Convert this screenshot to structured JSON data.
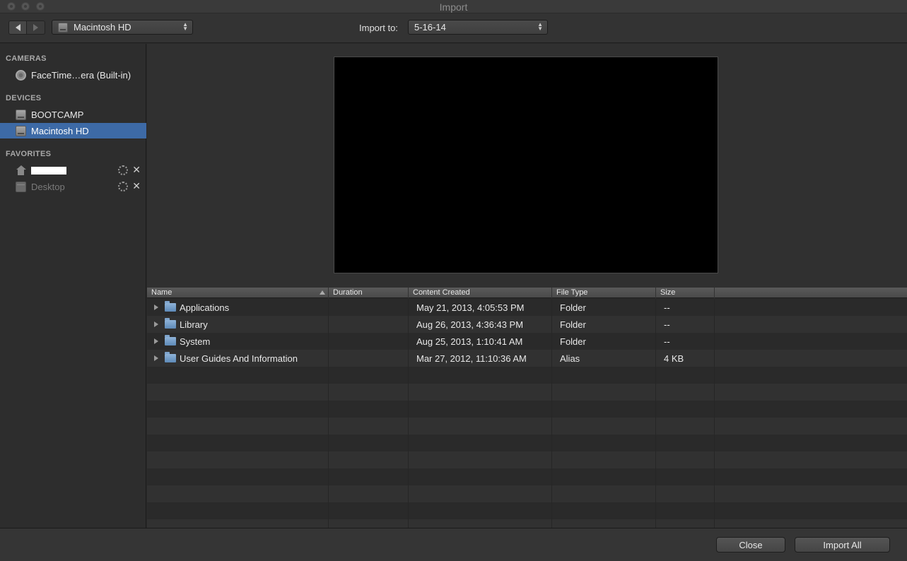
{
  "window": {
    "title": "Import"
  },
  "toolbar": {
    "source_selected": "Macintosh HD",
    "import_to_label": "Import to:",
    "event_selected": "5-16-14"
  },
  "sidebar": {
    "cameras_header": "CAMERAS",
    "cameras": [
      {
        "label": "FaceTime…era (Built-in)"
      }
    ],
    "devices_header": "DEVICES",
    "devices": [
      {
        "label": "BOOTCAMP"
      },
      {
        "label": "Macintosh HD"
      }
    ],
    "favorites_header": "FAVORITES",
    "favorites": [
      {
        "label": ""
      },
      {
        "label": "Desktop"
      }
    ]
  },
  "filelist": {
    "columns": [
      "Name",
      "Duration",
      "Content Created",
      "File Type",
      "Size"
    ],
    "rows": [
      {
        "name": "Applications",
        "duration": "",
        "created": "May 21, 2013, 4:05:53 PM",
        "type": "Folder",
        "size": "--"
      },
      {
        "name": "Library",
        "duration": "",
        "created": "Aug 26, 2013, 4:36:43 PM",
        "type": "Folder",
        "size": "--"
      },
      {
        "name": "System",
        "duration": "",
        "created": "Aug 25, 2013, 1:10:41 AM",
        "type": "Folder",
        "size": "--"
      },
      {
        "name": "User Guides And Information",
        "duration": "",
        "created": "Mar 27, 2012, 11:10:36 AM",
        "type": "Alias",
        "size": "4 KB"
      }
    ]
  },
  "buttons": {
    "close": "Close",
    "import_all": "Import All"
  },
  "colors": {
    "selection": "#3d6aa6",
    "background": "#2b2b2b",
    "folder": "#6f98c4"
  }
}
